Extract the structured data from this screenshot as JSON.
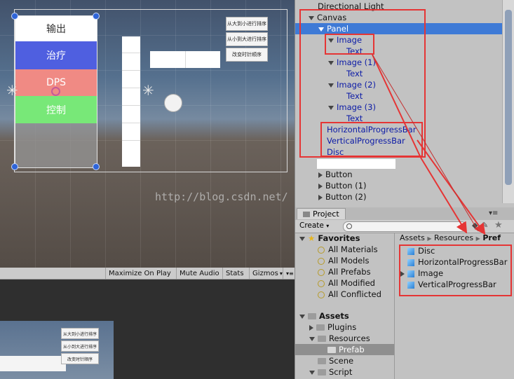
{
  "scene": {
    "side_buttons": [
      "从大到小进行排序",
      "从小到大进行排序",
      "改变时针顺序"
    ],
    "bands": [
      {
        "label": "输出",
        "color": "#ffffff",
        "text_color": "#333333"
      },
      {
        "label": "治疗",
        "color": "#4f5fe0",
        "text_color": "#ffffff"
      },
      {
        "label": "DPS",
        "color": "#f08a84",
        "text_color": "#ffffff"
      },
      {
        "label": "控制",
        "color": "#78e878",
        "text_color": "#ffffff"
      }
    ],
    "watermark": "http://blog.csdn.net/"
  },
  "game_toolbar": {
    "maximize": "Maximize On Play",
    "mute": "Mute Audio",
    "stats": "Stats",
    "gizmos": "Gizmos",
    "gizmos_arrow": "▾"
  },
  "game_view": {
    "buttons": [
      "从大到小进行排序",
      "从小到大进行排序",
      "改变时针顺序"
    ]
  },
  "hierarchy": {
    "rows": [
      {
        "label": "Directional Light"
      },
      {
        "label": "Canvas"
      },
      {
        "label": "Panel"
      },
      {
        "label": "Image"
      },
      {
        "label": "Text"
      },
      {
        "label": "Image (1)"
      },
      {
        "label": "Text"
      },
      {
        "label": "Image (2)"
      },
      {
        "label": "Text"
      },
      {
        "label": "Image (3)"
      },
      {
        "label": "Text"
      },
      {
        "label": "HorizontalProgressBar"
      },
      {
        "label": "VerticalProgressBar"
      },
      {
        "label": "Disc"
      },
      {
        "label": "Button"
      },
      {
        "label": "Button (1)"
      },
      {
        "label": "Button (2)"
      }
    ]
  },
  "project": {
    "tab": "Project",
    "create": "Create",
    "create_arrow": "▾",
    "breadcrumb": [
      "Assets",
      "Resources",
      "Pref"
    ],
    "favorites_title": "Favorites",
    "favorites": [
      "All Materials",
      "All Models",
      "All Prefabs",
      "All Modified",
      "All Conflicted"
    ],
    "assets_title": "Assets",
    "assets": [
      "Plugins",
      "Resources",
      "Prefab",
      "Scene",
      "Script"
    ],
    "prefabs": [
      "Disc",
      "HorizontalProgressBar",
      "Image",
      "VerticalProgressBar"
    ]
  },
  "colors": {
    "highlight": "#e53535",
    "selection": "#3e7ad6",
    "hierarchy_blue": "#0b1aa6"
  }
}
